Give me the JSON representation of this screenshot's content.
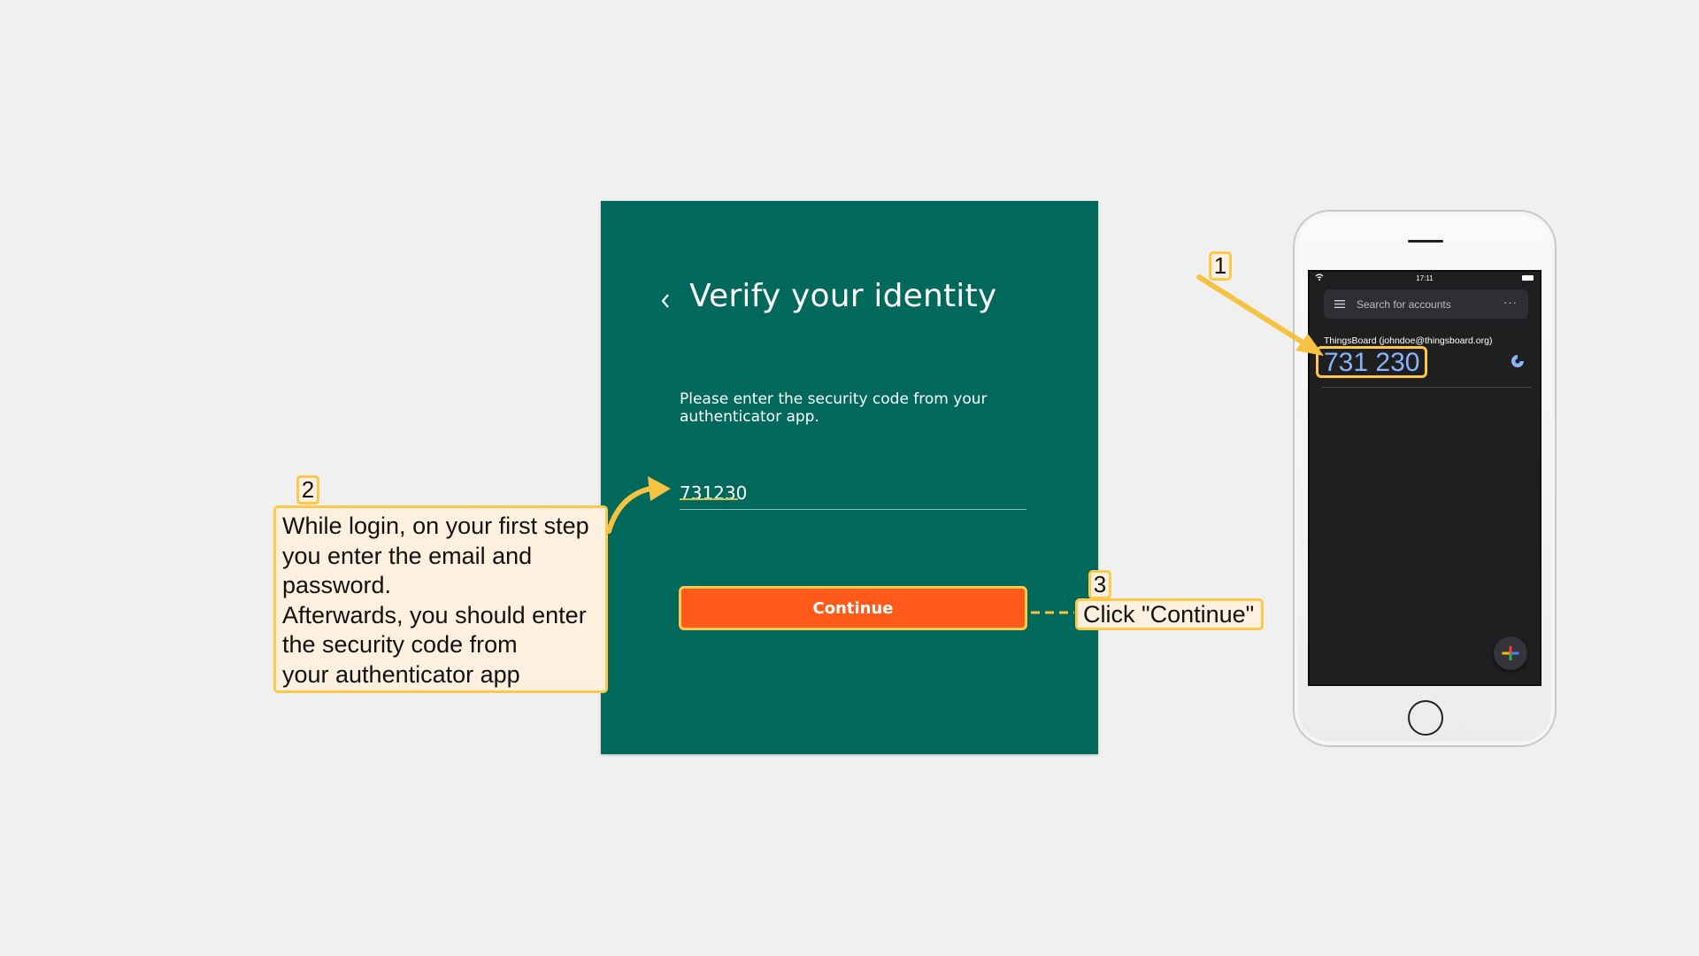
{
  "card": {
    "title": "Verify your identity",
    "description": "Please enter the security code from your authenticator app.",
    "code_value": "731230",
    "continue_label": "Continue"
  },
  "callouts": {
    "one": {
      "number": "1"
    },
    "two": {
      "number": "2",
      "lines": [
        "While login, on your first step",
        "you enter the email and",
        "password.",
        "Afterwards, you should enter",
        "the security code from",
        "your authenticator app"
      ]
    },
    "three": {
      "number": "3",
      "text": "Click \"Continue\""
    }
  },
  "phone": {
    "status_time": "17:11",
    "search_placeholder": "Search for accounts",
    "account_name": "ThingsBoard (johndoe@thingsboard.org)",
    "account_code": "731 230"
  },
  "colors": {
    "card_bg": "#00695c",
    "button_bg": "#ff5a19",
    "highlight": "#ffc84a",
    "callout_bg": "#fdf0de",
    "code_blue": "#8ab4f8"
  }
}
